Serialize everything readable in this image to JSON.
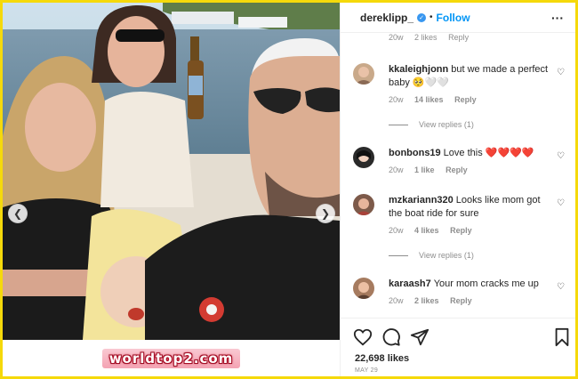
{
  "watermark": "worldtop2.com",
  "photo": {
    "prev_glyph": "❮",
    "next_glyph": "❯"
  },
  "header": {
    "username": "dereklipp_",
    "verified_glyph": "✓",
    "separator": "•",
    "follow_label": "Follow",
    "more_glyph": "···"
  },
  "partial_comment": {
    "time": "20w",
    "likes": "2 likes",
    "reply": "Reply"
  },
  "comments": [
    {
      "user": "kkaleighjonn",
      "text": "but we made a perfect baby 🥺🤍🤍",
      "time": "20w",
      "likes": "14 likes",
      "reply": "Reply",
      "view_replies": "View replies (1)"
    },
    {
      "user": "bonbons19",
      "text": "Love this ❤️❤️❤️❤️",
      "time": "20w",
      "likes": "1 like",
      "reply": "Reply",
      "view_replies": ""
    },
    {
      "user": "mzkariann320",
      "text": "Looks like mom got the boat ride for sure",
      "time": "20w",
      "likes": "4 likes",
      "reply": "Reply",
      "view_replies": "View replies (1)"
    },
    {
      "user": "karaash7",
      "text": "Your mom cracks me up",
      "time": "20w",
      "likes": "2 likes",
      "reply": "Reply",
      "view_replies": ""
    }
  ],
  "comment_like_glyph": "♡",
  "icons": {
    "like": "heart-icon",
    "comment": "comment-icon",
    "share": "share-icon",
    "save": "bookmark-icon"
  },
  "footer": {
    "likes": "22,698 likes",
    "date": "MAY 29"
  },
  "colors": {
    "frame": "#f5d90b",
    "link": "#0095f6",
    "muted": "#8e8e8e",
    "heart_red": "#e0245e"
  }
}
